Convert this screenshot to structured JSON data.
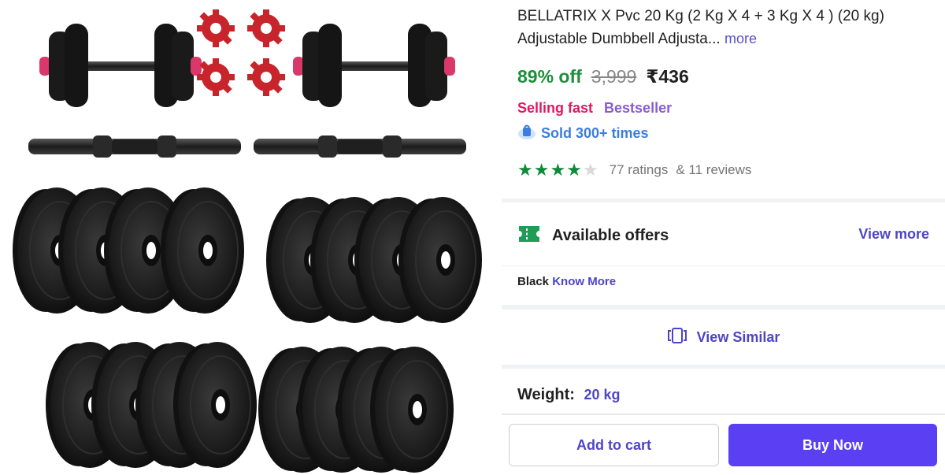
{
  "product": {
    "title": "BELLATRIX X Pvc 20 Kg (2 Kg X 4 + 3 Kg X 4 ) (20 kg) Adjustable Dumbbell Adjusta...",
    "more_label": "more",
    "discount": "89% off",
    "mrp": "3,999",
    "price": "₹436",
    "tags": {
      "selling_fast": "Selling fast",
      "bestseller": "Bestseller"
    },
    "sold": "Sold 300+ times",
    "rating": {
      "stars": 4,
      "max": 5,
      "ratings": "77 ratings",
      "reviews": "& 11 reviews"
    }
  },
  "offers": {
    "title": "Available offers",
    "view_more": "View more",
    "line_text": "Black",
    "know_more": "Know More"
  },
  "similar": {
    "label": "View Similar"
  },
  "spec": {
    "weight_label": "Weight:",
    "weight_value": "20 kg"
  },
  "actions": {
    "add_to_cart": "Add to cart",
    "buy_now": "Buy Now"
  },
  "icons": {
    "sold": "cloud-bag-icon",
    "offers": "ticket-icon",
    "similar": "similar-cards-icon"
  },
  "colors": {
    "accent": "#4d45c4",
    "buy": "#5b3ff2",
    "discount": "#1d8f3b",
    "selling_fast": "#e0185f",
    "bestseller": "#8a5bd6",
    "star": "#0f8a3a"
  }
}
